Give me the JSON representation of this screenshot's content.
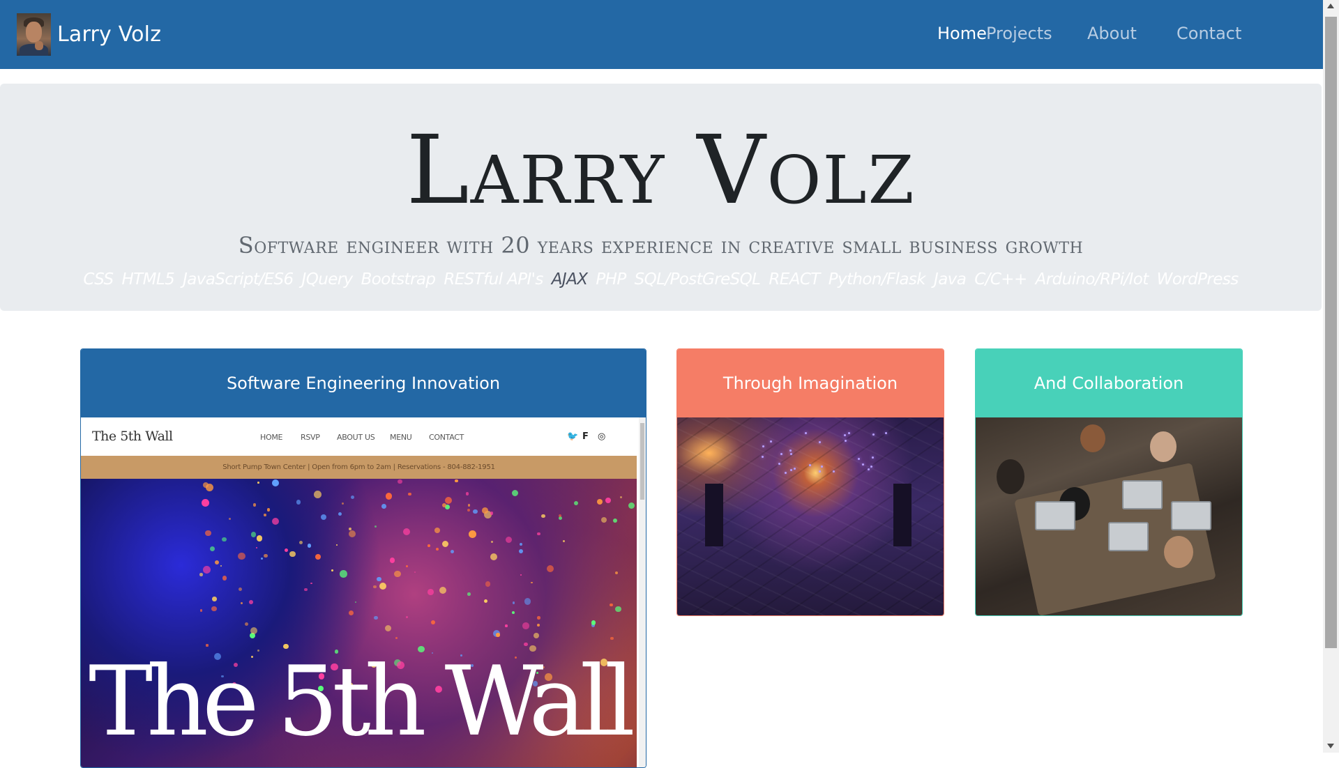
{
  "nav": {
    "brand": "Larry Volz",
    "links": [
      "Home",
      "Projects",
      "About",
      "Contact"
    ],
    "active": "Home",
    "colors": {
      "bar": "#2368a5",
      "active": "#ffffff",
      "inactive": "#b8cde3"
    }
  },
  "hero": {
    "title": "Larry Volz",
    "subtitle": "Software engineer with 20 years experience in creative small business growth",
    "skills": [
      "CSS",
      "HTML5",
      "JavaScript/ES6",
      "JQuery",
      "Bootstrap",
      "RESTful API's",
      "AJAX",
      "PHP",
      "SQL/PostGreSQL",
      "REACT",
      "Python/Flask",
      "Java",
      "C/C++",
      "Arduino/RPi/Iot",
      "WordPress"
    ],
    "highlighted_skill": "AJAX"
  },
  "cards": [
    {
      "title": "Software Engineering Innovation",
      "color": "#2368a5"
    },
    {
      "title": "Through Imagination",
      "color": "#f57d66"
    },
    {
      "title": "And Collaboration",
      "color": "#48d1b9"
    }
  ],
  "preview_site": {
    "brand": "The 5th Wall",
    "links": [
      "HOME",
      "RSVP",
      "ABOUT US",
      "MENU",
      "CONTACT"
    ],
    "social_icons": [
      "twitter-icon",
      "foursquare-icon",
      "instagram-icon"
    ],
    "info": "Short Pump Town Center  |  Open from 6pm to 2am  |  Reservations - 804-882-1951",
    "hero_title": "The 5th Wall"
  }
}
